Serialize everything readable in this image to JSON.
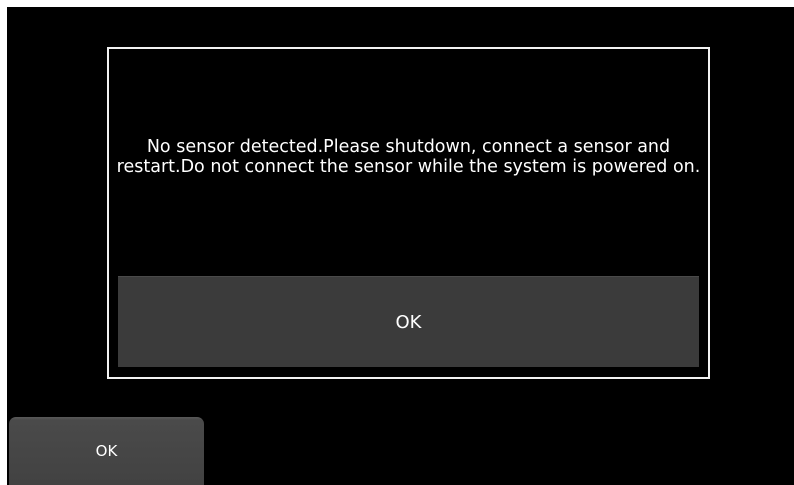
{
  "dialog": {
    "message": "No sensor detected.Please shutdown, connect a sensor and restart.Do not connect the sensor while the system is powered on.",
    "ok_label": "OK"
  },
  "footer": {
    "ok_label": "OK"
  },
  "colors": {
    "screen_background": "#000000",
    "dialog_border": "#f2f2f2",
    "dialog_button": "#3b3b3b",
    "footer_button": "#454545",
    "text": "#ffffff"
  }
}
